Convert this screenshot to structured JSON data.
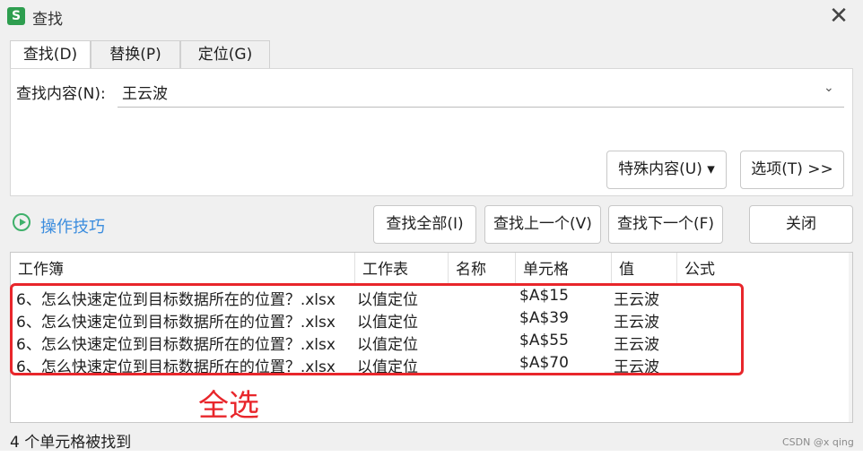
{
  "window": {
    "title": "查找",
    "app_icon": "S",
    "close_glyph": "✕"
  },
  "tabs": [
    {
      "label": "查找(D)"
    },
    {
      "label": "替换(P)"
    },
    {
      "label": "定位(G)"
    }
  ],
  "find": {
    "label": "查找内容(N):",
    "value": "王云波",
    "chevron": "⌄"
  },
  "buttons": {
    "special": "特殊内容(U) ▾",
    "options": "选项(T) >>",
    "find_all": "查找全部(I)",
    "find_prev": "查找上一个(V)",
    "find_next": "查找下一个(F)",
    "close": "关闭"
  },
  "tips": {
    "label": "操作技巧",
    "icon": "play-circle-icon"
  },
  "table": {
    "columns": [
      "工作簿",
      "工作表",
      "名称",
      "单元格",
      "值",
      "公式"
    ],
    "rows": [
      {
        "workbook": "6、怎么快速定位到目标数据所在的位置？.xlsx",
        "sheet": "以值定位",
        "name": "",
        "cell": "$A$15",
        "value": "王云波",
        "formula": ""
      },
      {
        "workbook": "6、怎么快速定位到目标数据所在的位置？.xlsx",
        "sheet": "以值定位",
        "name": "",
        "cell": "$A$39",
        "value": "王云波",
        "formula": ""
      },
      {
        "workbook": "6、怎么快速定位到目标数据所在的位置？.xlsx",
        "sheet": "以值定位",
        "name": "",
        "cell": "$A$55",
        "value": "王云波",
        "formula": ""
      },
      {
        "workbook": "6、怎么快速定位到目标数据所在的位置？.xlsx",
        "sheet": "以值定位",
        "name": "",
        "cell": "$A$70",
        "value": "王云波",
        "formula": ""
      }
    ]
  },
  "annotation": {
    "text": "全选",
    "color": "#e8262b"
  },
  "status": "4 个单元格被找到",
  "watermark": "CSDN @x qing"
}
